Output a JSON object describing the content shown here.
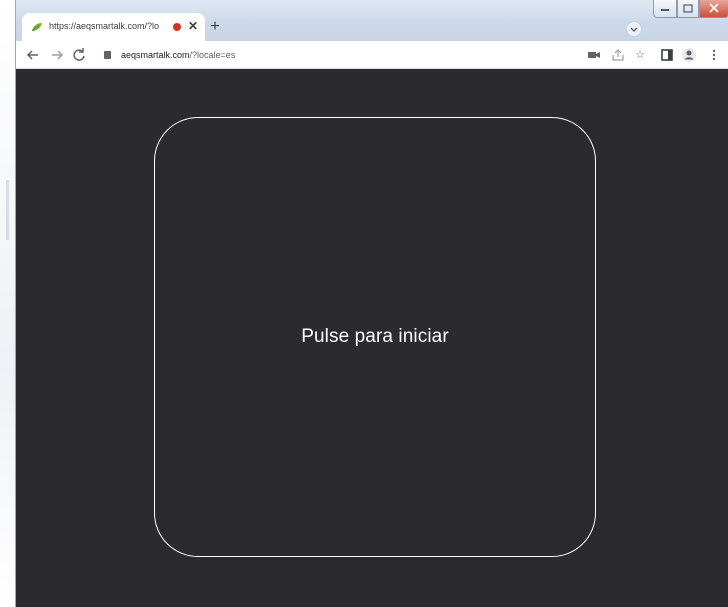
{
  "tab": {
    "title": "https://aeqsmartalk.com/?lo",
    "favicon": "green-leaf-icon"
  },
  "address_bar": {
    "host": "aeqsmartalk.com",
    "path": "/?locale=es"
  },
  "toolbar_icons": [
    "back-icon",
    "forward-icon",
    "reload-icon",
    "lock-icon",
    "video-icon",
    "share-icon",
    "star-icon",
    "side-panel-icon",
    "profile-icon",
    "menu-icon"
  ],
  "main": {
    "start_prompt": "Pulse para iniciar"
  },
  "colors": {
    "page_background": "#2a2a2f",
    "box_border": "#ffffff",
    "record_indicator": "#d93025"
  }
}
